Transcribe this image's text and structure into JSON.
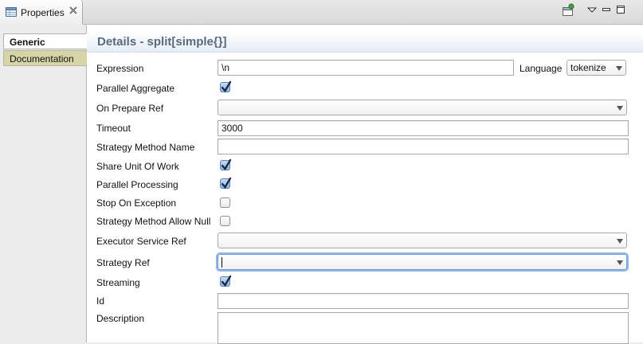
{
  "view": {
    "title": "Properties"
  },
  "side_tabs": [
    {
      "label": "Generic",
      "active": true
    },
    {
      "label": "Documentation",
      "active": false
    }
  ],
  "details": {
    "title": "Details - split[simple{}]"
  },
  "fields": {
    "expression": {
      "label": "Expression",
      "value": "\\n"
    },
    "language": {
      "label": "Language",
      "value": "tokenize"
    },
    "parallel_aggregate": {
      "label": "Parallel Aggregate",
      "checked": true
    },
    "on_prepare_ref": {
      "label": "On Prepare Ref",
      "value": ""
    },
    "timeout": {
      "label": "Timeout",
      "value": "3000"
    },
    "strategy_method_name": {
      "label": "Strategy Method Name",
      "value": ""
    },
    "share_unit_of_work": {
      "label": "Share Unit Of Work",
      "checked": true
    },
    "parallel_processing": {
      "label": "Parallel Processing",
      "checked": true
    },
    "stop_on_exception": {
      "label": "Stop On Exception",
      "checked": false
    },
    "strategy_method_allow_null": {
      "label": "Strategy Method Allow Null",
      "checked": false
    },
    "executor_service_ref": {
      "label": "Executor Service Ref",
      "value": ""
    },
    "strategy_ref": {
      "label": "Strategy Ref",
      "value": ""
    },
    "streaming": {
      "label": "Streaming",
      "checked": true
    },
    "id": {
      "label": "Id",
      "value": ""
    },
    "description": {
      "label": "Description",
      "value": ""
    }
  },
  "icons": {
    "view_icon": "properties-table-icon",
    "pin": "pin-icon",
    "menu": "view-menu-icon",
    "minimize": "minimize-icon",
    "maximize": "maximize-icon"
  },
  "colors": {
    "header_title": "#5a6a7d",
    "checkbox_checked": "#8db4e2",
    "inactive_tab": "#d7d4a8",
    "focus_ring": "#8fb7e8"
  }
}
